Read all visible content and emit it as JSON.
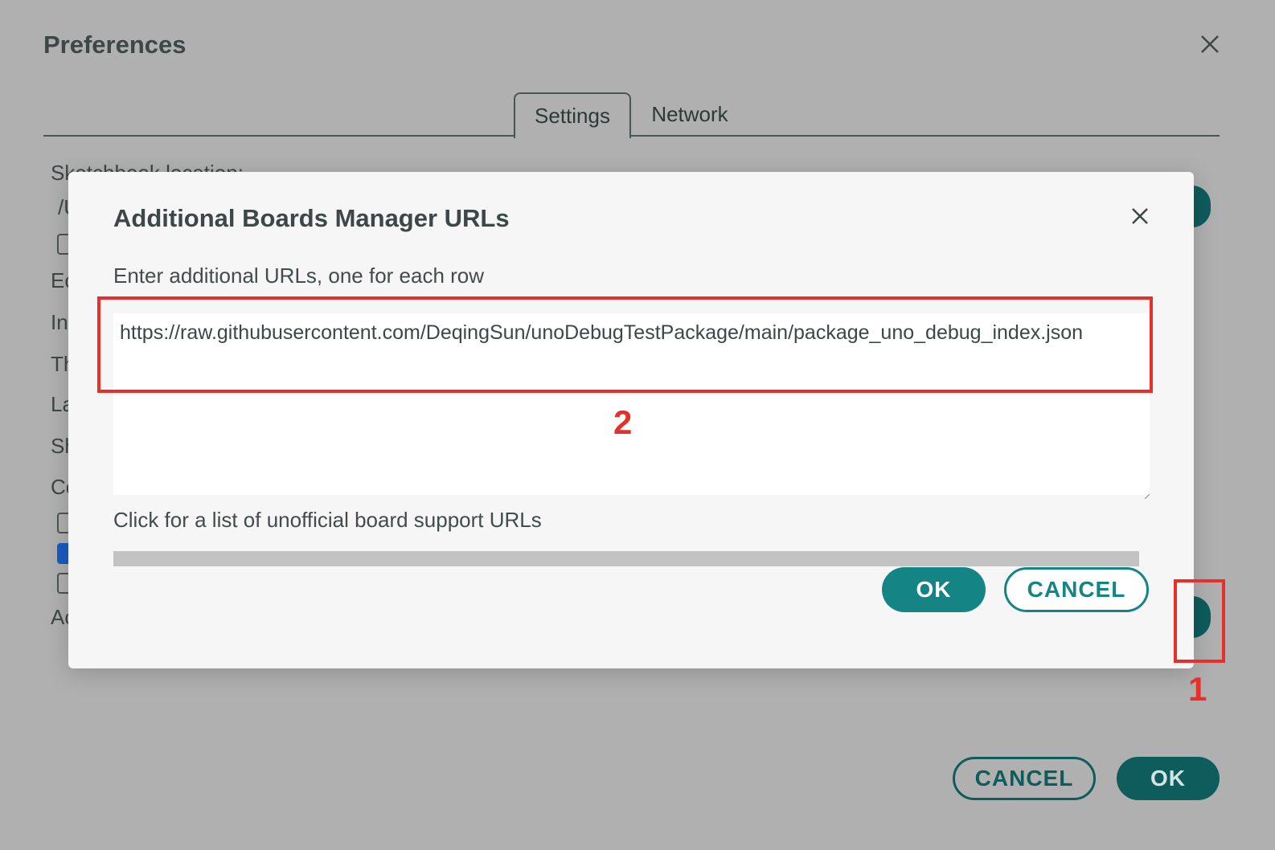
{
  "preferences": {
    "title": "Preferences",
    "tabs": [
      {
        "label": "Settings",
        "active": true
      },
      {
        "label": "Network",
        "active": false
      }
    ],
    "background_labels": [
      "Sketchbook location:",
      "/U",
      "Ec",
      "In",
      "Th",
      "La",
      "Sh",
      "Cc",
      "Ac"
    ],
    "cancel_label": "CANCEL",
    "ok_label": "OK"
  },
  "dialog": {
    "title": "Additional Boards Manager URLs",
    "instruction": "Enter additional URLs, one for each row",
    "urls": [
      "https://raw.githubusercontent.com/DeqingSun/unoDebugTestPackage/main/package_uno_debug_index.json"
    ],
    "link_text": "Click for a list of unofficial board support URLs",
    "ok_label": "OK",
    "cancel_label": "CANCEL"
  },
  "annotations": {
    "box1_number": "1",
    "box2_number": "2",
    "color": "#e8302a"
  },
  "colors": {
    "accent": "#158484",
    "accent_dark": "#0e5c5c",
    "overlay": "#afb0af"
  }
}
